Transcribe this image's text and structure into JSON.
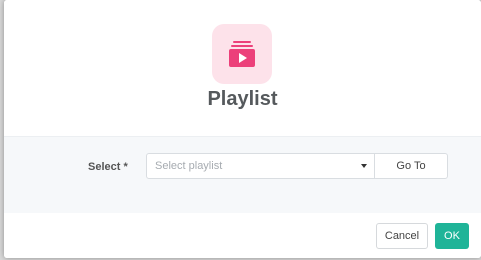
{
  "dialog": {
    "title": "Playlist",
    "icon": "playlist-icon",
    "accent_color": "#ec407a",
    "icon_bg_color": "#fde2ea"
  },
  "form": {
    "select_label": "Select *",
    "select_placeholder": "Select playlist",
    "goto_label": "Go To"
  },
  "footer": {
    "cancel_label": "Cancel",
    "ok_label": "OK",
    "ok_color": "#1fb498"
  }
}
